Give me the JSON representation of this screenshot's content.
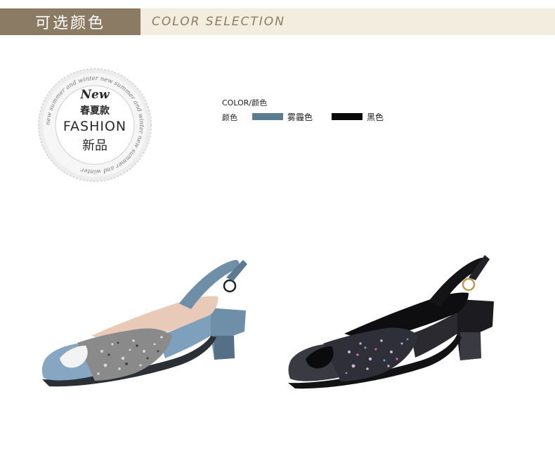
{
  "header": {
    "title_cn": "可选颜色",
    "title_en": "COLOR SELECTION",
    "bg_dark": "#8c7b64",
    "bg_light": "#f3eddf"
  },
  "badge": {
    "ring_text": "new summer and winter new summer and winter new summer and winter",
    "new": "New",
    "season": "春夏款",
    "fashion": "FASHION",
    "new_product": "新品"
  },
  "colors": {
    "title": "COLOR/颜色",
    "label": "颜色",
    "options": [
      {
        "name": "雾霾色",
        "hex": "#5b7c91"
      },
      {
        "name": "黑色",
        "hex": "#0a0a0a"
      }
    ]
  },
  "products": [
    {
      "image": "blue-gray glitter peep-toe slingback sandal",
      "color": "#7b9ab3"
    },
    {
      "image": "black glitter peep-toe slingback sandal",
      "color": "#1a1a1e"
    }
  ]
}
